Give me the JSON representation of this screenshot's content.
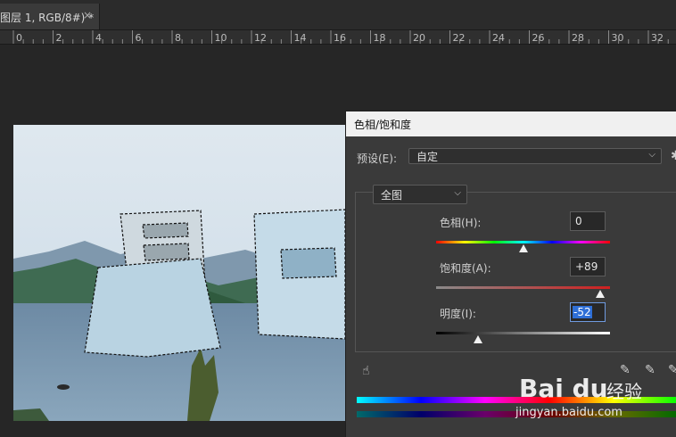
{
  "tab": {
    "title": "图层 1, RGB/8#) *",
    "close": "×"
  },
  "ruler": {
    "labels": [
      "0",
      "2",
      "4",
      "6",
      "8",
      "10",
      "12",
      "14",
      "16",
      "18",
      "20",
      "22",
      "24",
      "26",
      "28",
      "30",
      "32"
    ]
  },
  "dialog": {
    "title": "色相/饱和度",
    "preset_label": "预设(E):",
    "preset_value": "自定",
    "channel_value": "全图",
    "hue": {
      "label": "色相(H):",
      "value": "0",
      "level": 0
    },
    "saturation": {
      "label": "饱和度(A):",
      "value": "+89",
      "level": 89
    },
    "lightness": {
      "label": "明度(I):",
      "value": "-52",
      "level": -52
    },
    "gear_icon": "settings-gear",
    "chevron": "⌵"
  },
  "watermark": {
    "brand": "Bai du",
    "jingyan": "经验",
    "url": "jingyan.baidu.com"
  },
  "colors": {
    "panel": "#3a3a3a",
    "accent": "#2f6fd6",
    "workspace": "#262626"
  }
}
